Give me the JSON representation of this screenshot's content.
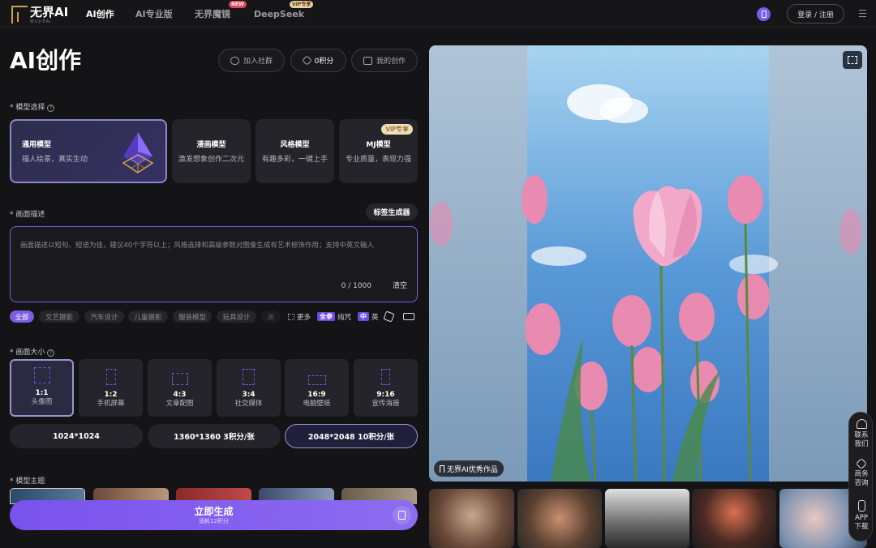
{
  "header": {
    "logo_text": "无界AI",
    "logo_sub": "WUJIEAI",
    "nav": [
      {
        "label": "AI创作",
        "active": true
      },
      {
        "label": "AI专业版",
        "active": false
      },
      {
        "label": "无界魔镜",
        "badge": "NEW"
      },
      {
        "label": "DeepSeek",
        "badge": "VIP专享"
      }
    ],
    "login_label": "登录 / 注册",
    "phone_icon": "phone-icon",
    "menu_icon": "hamburger-icon"
  },
  "page": {
    "title": "AI创作",
    "actions": [
      {
        "label": "加入社群",
        "icon": "chat-icon"
      },
      {
        "label": "0积分",
        "icon": "coin-icon"
      },
      {
        "label": "我的创作",
        "icon": "folder-icon"
      }
    ]
  },
  "model_section": {
    "label": "* 模型选择",
    "models": [
      {
        "title": "通用模型",
        "sub": "描人绘景，真实生动",
        "selected": true
      },
      {
        "title": "漫画模型",
        "sub": "激发想象创作二次元"
      },
      {
        "title": "风格模型",
        "sub": "有趣多彩，一键上手"
      },
      {
        "title": "MJ模型",
        "sub": "专业质量，表现力强",
        "badge": "VIP专享"
      }
    ]
  },
  "prompt_section": {
    "label": "* 画面描述",
    "tag_generator": "标签生成器",
    "placeholder": "画面描述以短句、短语为佳，建议40个字符以上；风格选择和高级参数对图像生成有艺术修饰作用；支持中英文输入",
    "counter": "0 / 1000",
    "clear_label": "清空",
    "tags": [
      "全部",
      "文艺摄影",
      "汽车设计",
      "儿童摄影",
      "服装模型",
      "玩具设计",
      "美"
    ],
    "more_label": "更多",
    "full_tag": "全参",
    "spell_label": "纯咒",
    "lang_zh": "中",
    "lang_en": "英"
  },
  "size_section": {
    "label": "* 画面大小",
    "sizes": [
      {
        "ratio": "1:1",
        "name": "头像图",
        "selected": true
      },
      {
        "ratio": "1:2",
        "name": "手机屏幕"
      },
      {
        "ratio": "4:3",
        "name": "文章配图"
      },
      {
        "ratio": "3:4",
        "name": "社交媒体"
      },
      {
        "ratio": "16:9",
        "name": "电脑壁纸"
      },
      {
        "ratio": "9:16",
        "name": "宣传海报"
      }
    ],
    "resolutions": [
      {
        "label": "1024*1024",
        "selected": false
      },
      {
        "label": "1360*1360 3积分/张",
        "selected": false
      },
      {
        "label": "2048*2048 10积分/张",
        "selected": true
      }
    ]
  },
  "theme_section": {
    "label": "* 模型主题"
  },
  "generate": {
    "label": "立即生成",
    "sub": "消耗12积分"
  },
  "preview": {
    "watermark": "无界AI优秀作品"
  },
  "side_float": [
    {
      "label": "联系我们",
      "icon": "headset-icon"
    },
    {
      "label": "商务咨询",
      "icon": "handshake-icon"
    },
    {
      "label": "APP下载",
      "icon": "mobile-icon"
    }
  ],
  "colors": {
    "accent": "#7c5ce0",
    "bg": "#141416",
    "card": "#24242a",
    "vip": "#f0dcb5"
  }
}
